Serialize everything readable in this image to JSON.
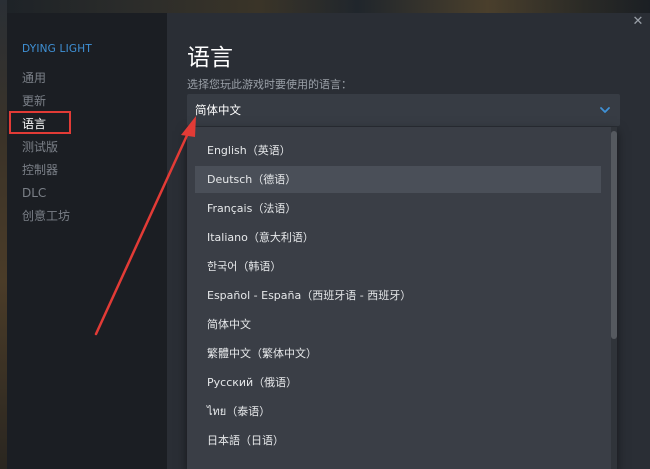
{
  "sidebar": {
    "game_title": "DYING LIGHT",
    "items": [
      {
        "label": "通用",
        "active": false
      },
      {
        "label": "更新",
        "active": false
      },
      {
        "label": "语言",
        "active": true
      },
      {
        "label": "测试版",
        "active": false
      },
      {
        "label": "控制器",
        "active": false
      },
      {
        "label": "DLC",
        "active": false
      },
      {
        "label": "创意工坊",
        "active": false
      }
    ]
  },
  "main": {
    "title": "语言",
    "prompt": "选择您玩此游戏时要使用的语言：",
    "select": {
      "value": "简体中文",
      "icon": "chevron-down-icon"
    },
    "dropdown_options": [
      "English（英语）",
      "Deutsch（德语）",
      "Français（法语）",
      "Italiano（意大利语）",
      "한국어（韩语）",
      "Español - España（西班牙语 - 西班牙）",
      "简体中文",
      "繁體中文（繁体中文）",
      "Русский（俄语）",
      "ไทย（泰语）",
      "日本語（日语）"
    ],
    "hovered_option": "Deutsch（德语）"
  },
  "window": {
    "close_icon": "close-icon"
  },
  "colors": {
    "accent": "#3f91d6",
    "annotation": "#e23b36"
  }
}
